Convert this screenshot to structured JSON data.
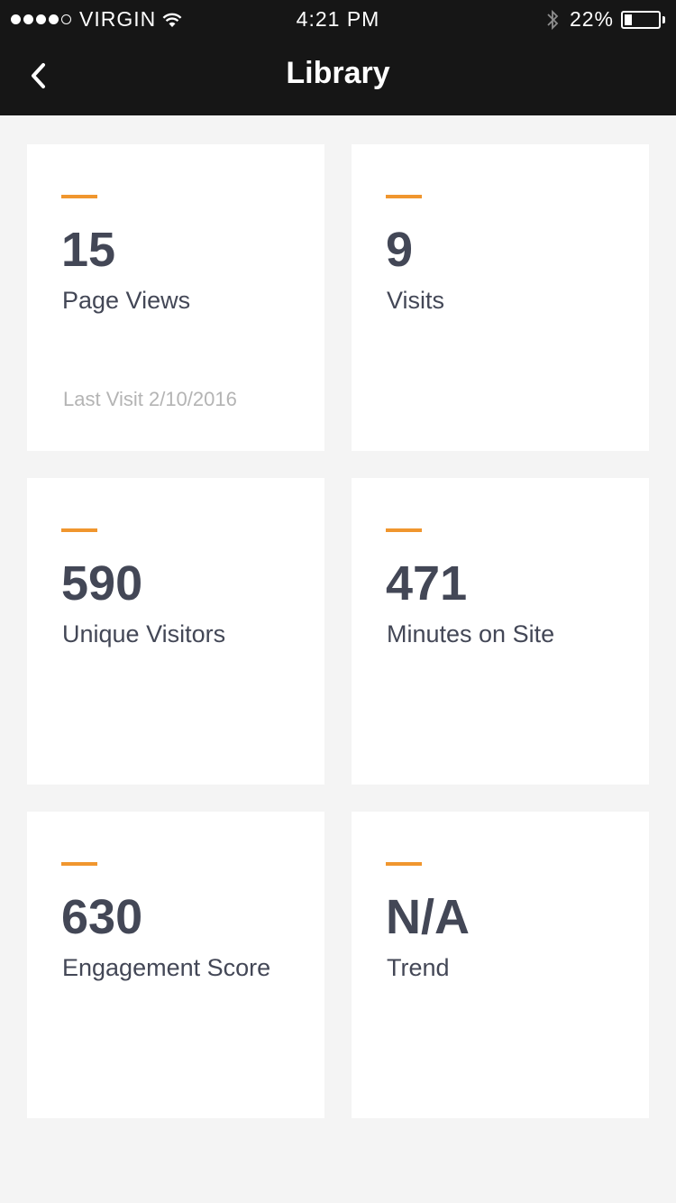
{
  "status_bar": {
    "carrier": "VIRGIN",
    "time": "4:21 PM",
    "battery_percent": "22%",
    "battery_level": 0.22
  },
  "nav": {
    "title": "Library",
    "back_icon": "chevron-left-icon"
  },
  "colors": {
    "bar_background": "#161616",
    "page_background": "#f4f4f4",
    "accent": "#f0962e",
    "value_text": "#434756",
    "muted_text": "#b4b4b4"
  },
  "cards": [
    {
      "value": "15",
      "label": "Page Views",
      "sub": "Last Visit 2/10/2016"
    },
    {
      "value": "9",
      "label": "Visits"
    },
    {
      "value": "590",
      "label": "Unique Visitors"
    },
    {
      "value": "471",
      "label": "Minutes on Site"
    },
    {
      "value": "630",
      "label": "Engagement Score"
    },
    {
      "value": "N/A",
      "label": "Trend"
    }
  ]
}
